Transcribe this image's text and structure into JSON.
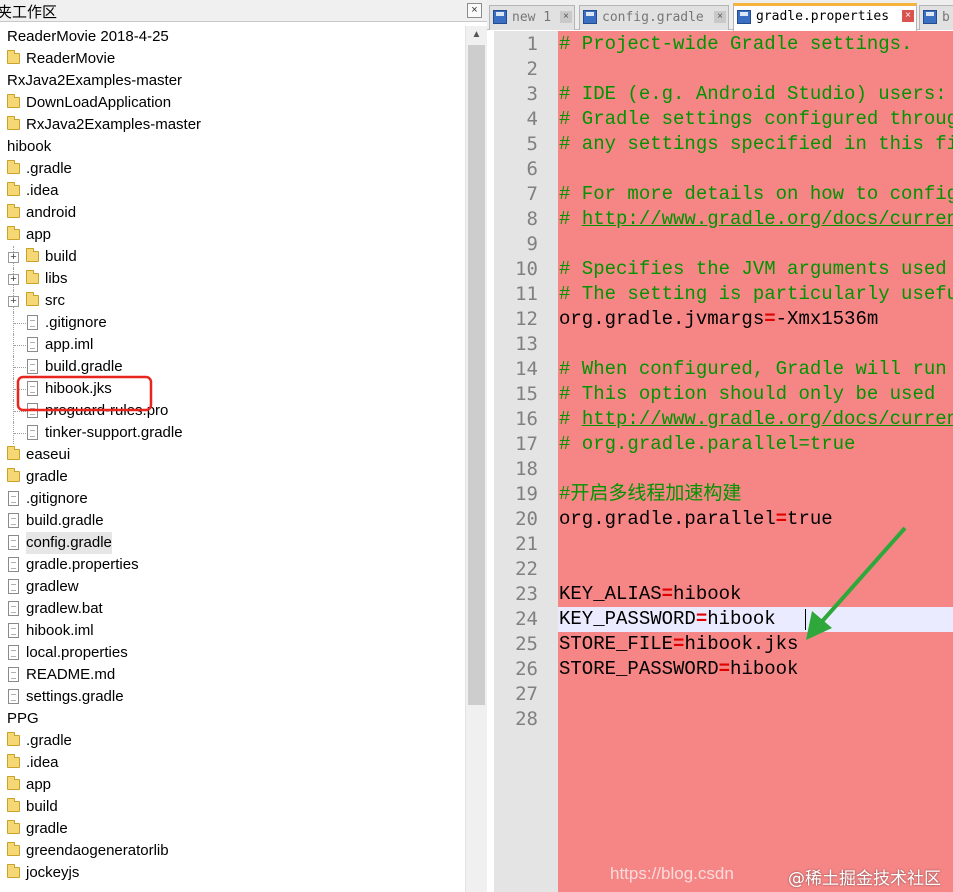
{
  "panel": {
    "title": "夹工作区",
    "close_glyph": "×"
  },
  "tree": [
    {
      "label": "ReaderMovie 2018-4-25",
      "indent": 0,
      "kind": "root"
    },
    {
      "label": "ReaderMovie",
      "indent": 1,
      "kind": "folder"
    },
    {
      "label": "RxJava2Examples-master",
      "indent": 0,
      "kind": "root"
    },
    {
      "label": "DownLoadApplication",
      "indent": 1,
      "kind": "folder"
    },
    {
      "label": "RxJava2Examples-master",
      "indent": 1,
      "kind": "folder"
    },
    {
      "label": "hibook",
      "indent": 0,
      "kind": "root"
    },
    {
      "label": ".gradle",
      "indent": 1,
      "kind": "folder"
    },
    {
      "label": ".idea",
      "indent": 1,
      "kind": "folder"
    },
    {
      "label": "android",
      "indent": 1,
      "kind": "folder"
    },
    {
      "label": "app",
      "indent": 1,
      "kind": "folder-open"
    },
    {
      "label": "build",
      "indent": 2,
      "kind": "folder",
      "expander": "+"
    },
    {
      "label": "libs",
      "indent": 2,
      "kind": "folder",
      "expander": "+"
    },
    {
      "label": "src",
      "indent": 2,
      "kind": "folder",
      "expander": "+"
    },
    {
      "label": ".gitignore",
      "indent": 2,
      "kind": "file"
    },
    {
      "label": "app.iml",
      "indent": 2,
      "kind": "file"
    },
    {
      "label": "build.gradle",
      "indent": 2,
      "kind": "file"
    },
    {
      "label": "hibook.jks",
      "indent": 2,
      "kind": "file",
      "boxed": true
    },
    {
      "label": "proguard-rules.pro",
      "indent": 2,
      "kind": "file"
    },
    {
      "label": "tinker-support.gradle",
      "indent": 2,
      "kind": "file"
    },
    {
      "label": "easeui",
      "indent": 1,
      "kind": "folder"
    },
    {
      "label": "gradle",
      "indent": 1,
      "kind": "folder"
    },
    {
      "label": ".gitignore",
      "indent": 1,
      "kind": "file"
    },
    {
      "label": "build.gradle",
      "indent": 1,
      "kind": "file"
    },
    {
      "label": "config.gradle",
      "indent": 1,
      "kind": "file",
      "highlight": true
    },
    {
      "label": "gradle.properties",
      "indent": 1,
      "kind": "file"
    },
    {
      "label": "gradlew",
      "indent": 1,
      "kind": "file"
    },
    {
      "label": "gradlew.bat",
      "indent": 1,
      "kind": "file"
    },
    {
      "label": "hibook.iml",
      "indent": 1,
      "kind": "file"
    },
    {
      "label": "local.properties",
      "indent": 1,
      "kind": "file"
    },
    {
      "label": "README.md",
      "indent": 1,
      "kind": "file"
    },
    {
      "label": "settings.gradle",
      "indent": 1,
      "kind": "file"
    },
    {
      "label": "PPG",
      "indent": 0,
      "kind": "root"
    },
    {
      "label": ".gradle",
      "indent": 1,
      "kind": "folder"
    },
    {
      "label": ".idea",
      "indent": 1,
      "kind": "folder"
    },
    {
      "label": "app",
      "indent": 1,
      "kind": "folder"
    },
    {
      "label": "build",
      "indent": 1,
      "kind": "folder"
    },
    {
      "label": "gradle",
      "indent": 1,
      "kind": "folder"
    },
    {
      "label": "greendaogeneratorlib",
      "indent": 1,
      "kind": "folder"
    },
    {
      "label": "jockeyjs",
      "indent": 1,
      "kind": "folder"
    }
  ],
  "scrollbar": {
    "up_glyph": "▲"
  },
  "tabs": [
    {
      "label": "new 1",
      "active": false,
      "close": "×"
    },
    {
      "label": "config.gradle",
      "active": false,
      "close": "×"
    },
    {
      "label": "gradle.properties",
      "active": true,
      "close": "×"
    },
    {
      "label": "b",
      "active": false,
      "close": ""
    }
  ],
  "lines": [
    {
      "n": "1",
      "text": "# Project-wide Gradle settings.",
      "type": "comment"
    },
    {
      "n": "2",
      "text": "",
      "type": "blank"
    },
    {
      "n": "3",
      "text": "# IDE (e.g. Android Studio) users:",
      "type": "comment"
    },
    {
      "n": "4",
      "text": "# Gradle settings configured through the IDE",
      "type": "comment"
    },
    {
      "n": "5",
      "text": "# any settings specified in this file.",
      "type": "comment"
    },
    {
      "n": "6",
      "text": "",
      "type": "blank"
    },
    {
      "n": "7",
      "text": "# For more details on how to configure",
      "type": "comment"
    },
    {
      "n": "8",
      "text": "# ",
      "url": "http://www.gradle.org/docs/current",
      "type": "comment-url"
    },
    {
      "n": "9",
      "text": "",
      "type": "blank"
    },
    {
      "n": "10",
      "text": "# Specifies the JVM arguments used",
      "type": "comment"
    },
    {
      "n": "11",
      "text": "# The setting is particularly useful",
      "type": "comment"
    },
    {
      "n": "12",
      "key": "org.gradle.jvmargs",
      "value": "-Xmx1536m",
      "type": "kv"
    },
    {
      "n": "13",
      "text": "",
      "type": "blank"
    },
    {
      "n": "14",
      "text": "# When configured, Gradle will run",
      "type": "comment"
    },
    {
      "n": "15",
      "text": "# This option should only be used",
      "type": "comment"
    },
    {
      "n": "16",
      "text": "# ",
      "url": "http://www.gradle.org/docs/current",
      "type": "comment-url"
    },
    {
      "n": "17",
      "text": "# org.gradle.parallel=true",
      "type": "comment"
    },
    {
      "n": "18",
      "text": "",
      "type": "blank"
    },
    {
      "n": "19",
      "text": "#开启多线程加速构建",
      "type": "comment"
    },
    {
      "n": "20",
      "key": "org.gradle.parallel",
      "value": "true",
      "type": "kv"
    },
    {
      "n": "21",
      "text": "",
      "type": "blank"
    },
    {
      "n": "22",
      "text": "",
      "type": "blank"
    },
    {
      "n": "23",
      "key": "KEY_ALIAS",
      "value": "hibook",
      "type": "kv"
    },
    {
      "n": "24",
      "key": "KEY_PASSWORD",
      "value": "hibook",
      "type": "kv"
    },
    {
      "n": "25",
      "key": "STORE_FILE",
      "value": "hibook.jks",
      "type": "kv"
    },
    {
      "n": "26",
      "key": "STORE_PASSWORD",
      "value": "hibook",
      "type": "kv"
    },
    {
      "n": "27",
      "text": "",
      "type": "blank"
    },
    {
      "n": "28",
      "text": "",
      "type": "blank"
    }
  ],
  "eq_sign": "=",
  "watermark": {
    "url": "https://blog.csdn",
    "brand": "@稀土掘金技术社区"
  },
  "colors": {
    "annotation_box": "#e8261e",
    "arrow": "#2ea83a",
    "editor_bg": "#f68686",
    "comment": "#009400",
    "operator": "#e00000"
  }
}
